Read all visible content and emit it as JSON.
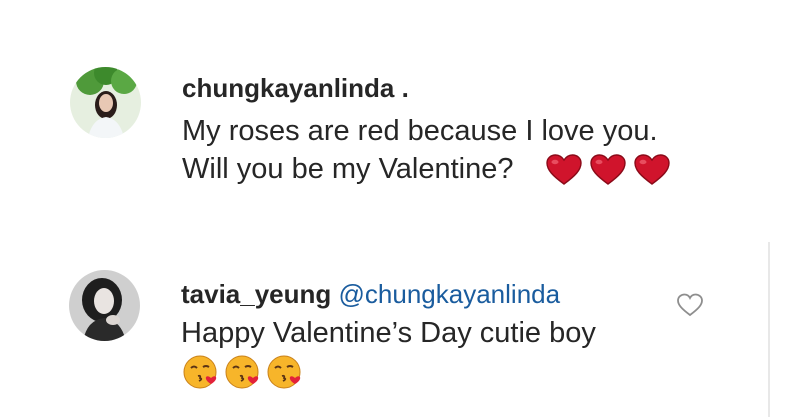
{
  "comments": [
    {
      "username": "chungkayanlinda .",
      "lines": [
        "My roses are red because I love you.",
        "Will you be my Valentine?"
      ],
      "emoji_icons": [
        "red-heart-icon",
        "red-heart-icon",
        "red-heart-icon"
      ]
    },
    {
      "username": "tavia_yeung",
      "mention": "@chungkayanlinda",
      "lines": [
        "Happy Valentine’s Day cutie boy"
      ],
      "emoji_icons": [
        "face-blowing-kiss-icon",
        "face-blowing-kiss-icon",
        "face-blowing-kiss-icon"
      ]
    }
  ],
  "colors": {
    "text": "#262626",
    "mention": "#1a5c9e",
    "heart": "#d0142c",
    "emoji_face": "#f7b52a"
  }
}
